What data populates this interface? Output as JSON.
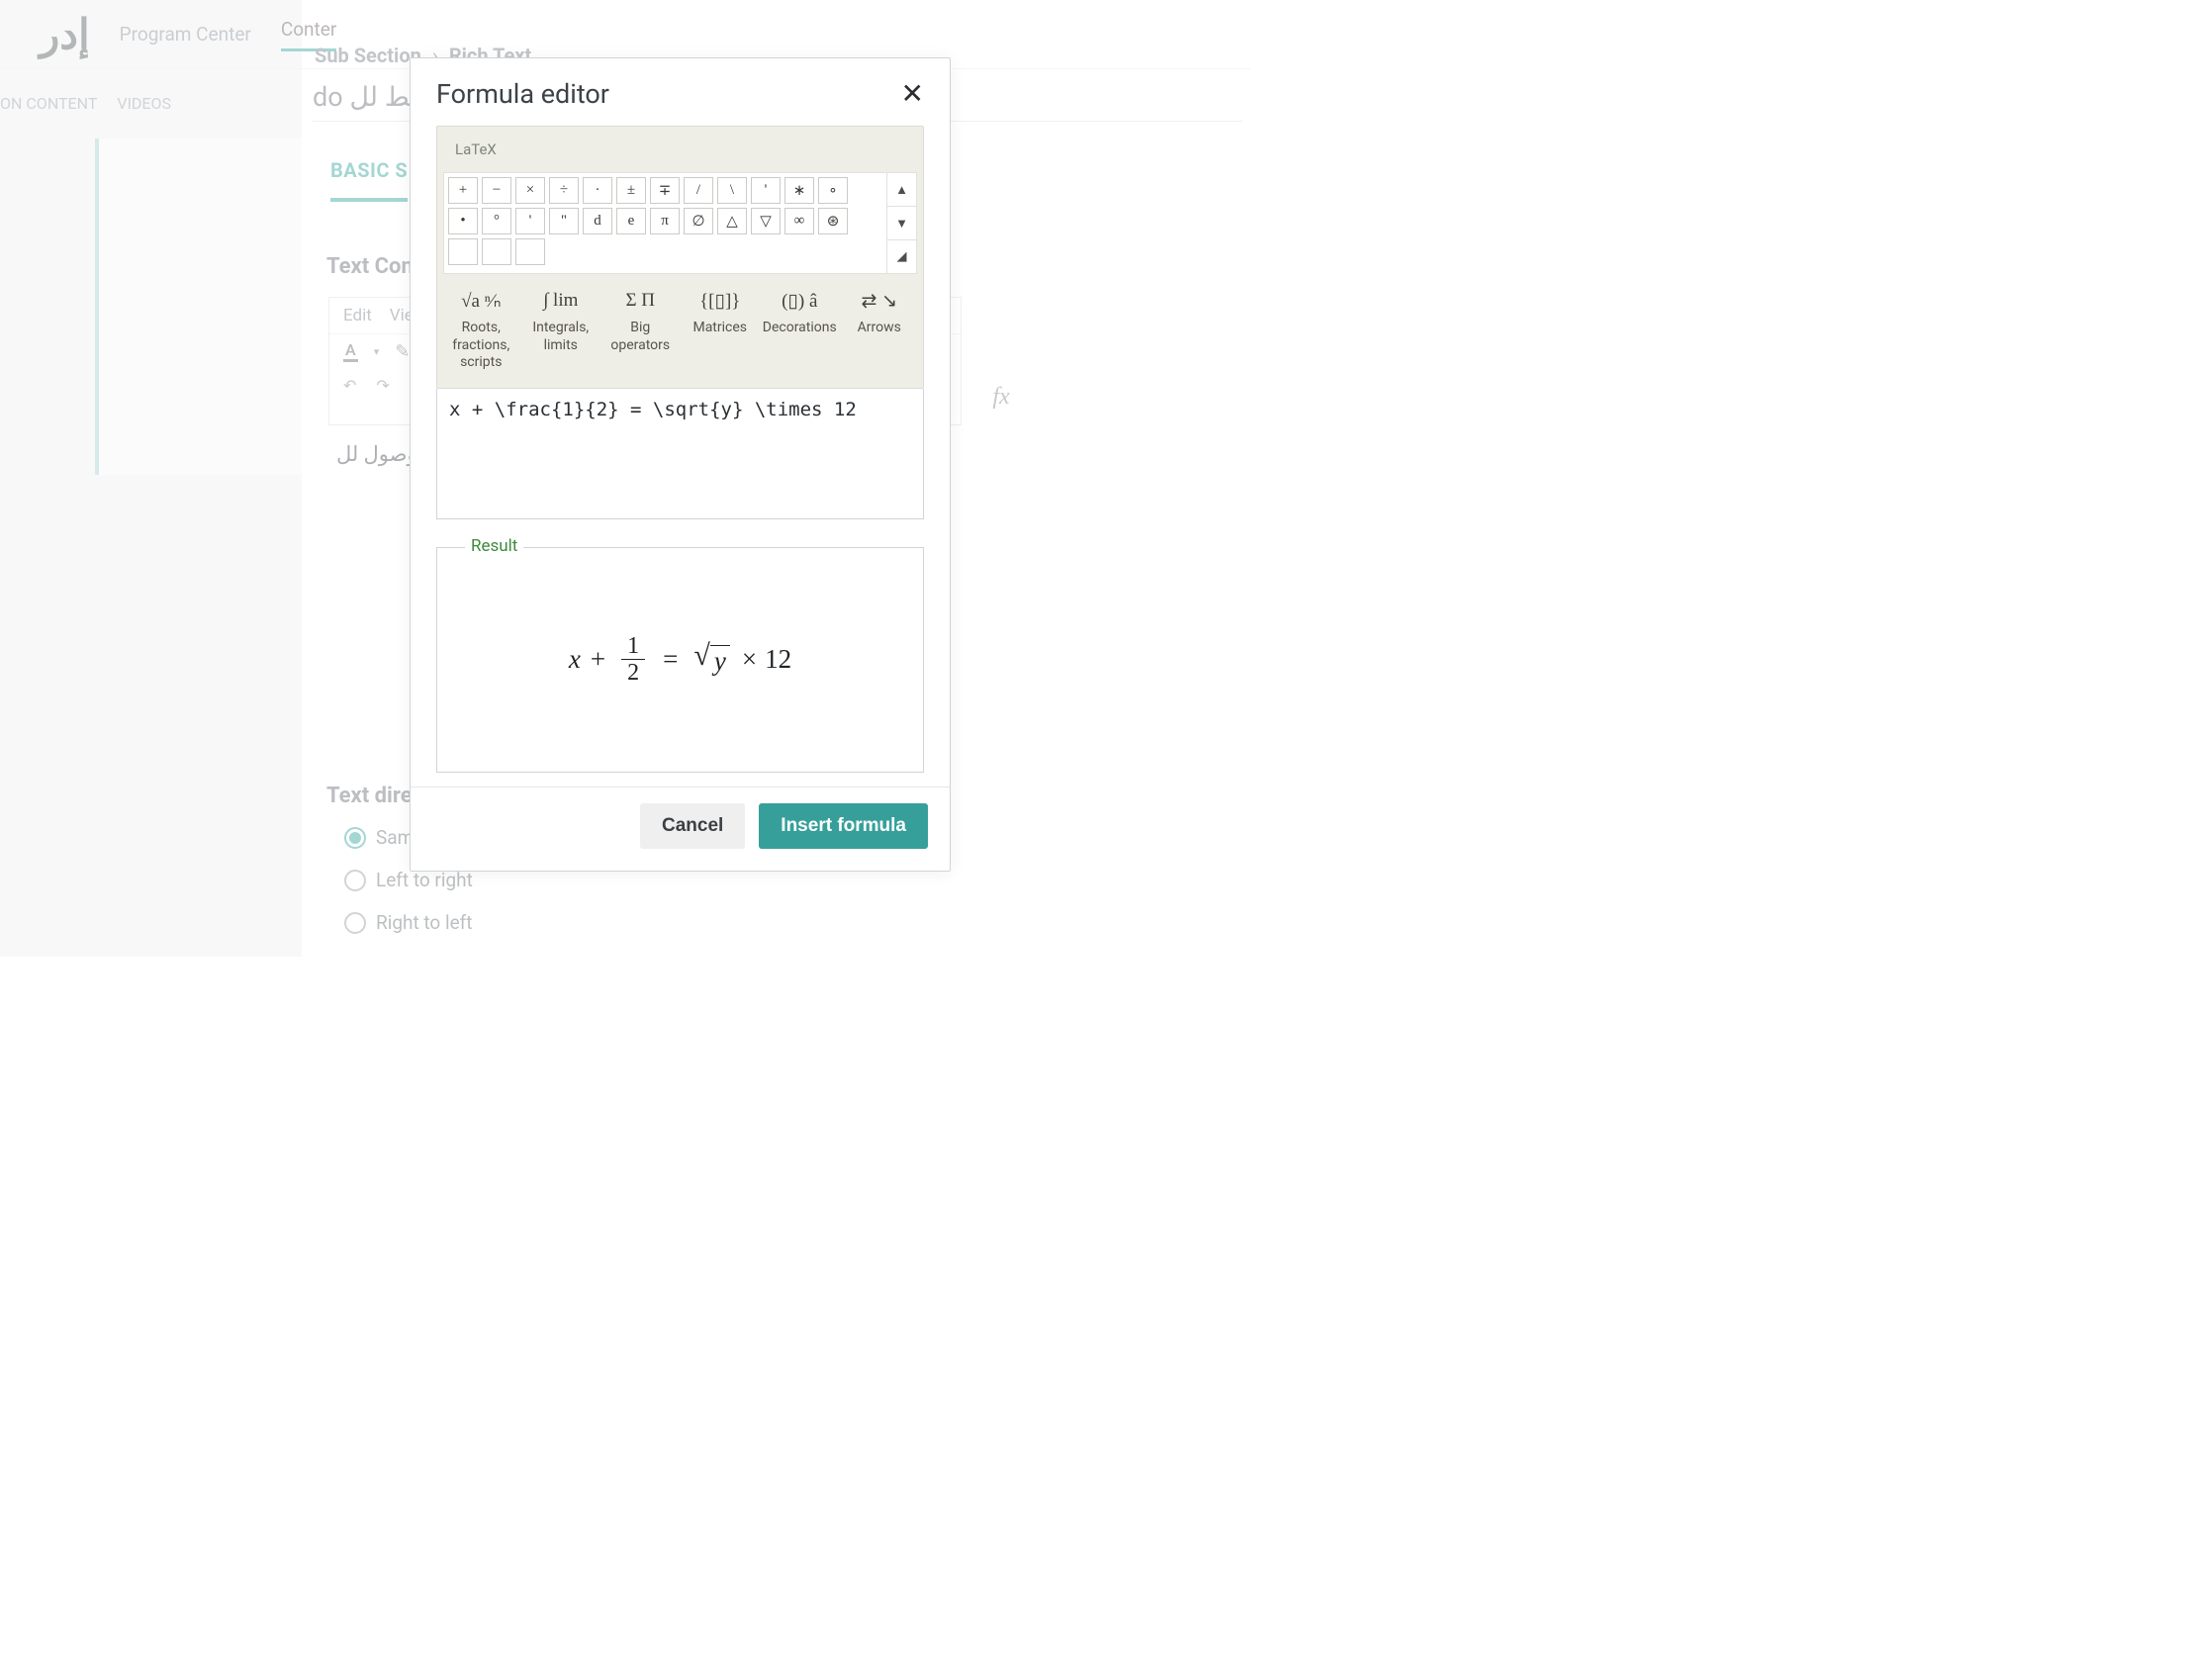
{
  "topnav": {
    "program_center": "Program Center",
    "content": "Conter"
  },
  "subnav": {
    "on_content": "ON CONTENT",
    "videos": "VIDEOS"
  },
  "breadcrumb": {
    "a": "Sub Section",
    "sep": "›",
    "b": "Rich Text"
  },
  "title": "do رابط لل",
  "tabs": {
    "basic": "BASIC S"
  },
  "sections": {
    "text_content": "Text Con",
    "text_direction": "Text dire"
  },
  "menubar": {
    "edit": "Edit",
    "view": "Vie"
  },
  "arabic_body": "الوصول لل",
  "fx": "fx",
  "radios": {
    "same": "Sam",
    "ltr": "Left to right",
    "rtl": "Right to left"
  },
  "modal": {
    "title": "Formula editor",
    "latex_label": "LaTeX",
    "input": "x + \\frac{1}{2} = \\sqrt{y} \\times 12",
    "result_label": "Result",
    "cancel": "Cancel",
    "insert": "Insert formula"
  },
  "symbols": {
    "row1": [
      "+",
      "−",
      "×",
      "÷",
      "·",
      "±",
      "∓",
      "/",
      "\\",
      "'",
      "∗",
      "∘"
    ],
    "row2": [
      "•",
      "°",
      "'",
      "''",
      "d",
      "e",
      "π",
      "∅",
      "△",
      "▽",
      "∞",
      "⊛"
    ]
  },
  "cats": {
    "roots": {
      "icon": "√a ⁿ⁄ₙ",
      "label": "Roots, fractions, scripts"
    },
    "integrals": {
      "icon": "∫ lim",
      "label": "Integrals, limits"
    },
    "bigops": {
      "icon": "Σ Π",
      "label": "Big operators"
    },
    "matrices": {
      "icon": "{[▯]}",
      "label": "Matrices"
    },
    "decor": {
      "icon": "(▯) â",
      "label": "Decorations"
    },
    "arrows": {
      "icon": "⇄ ↘",
      "label": "Arrows"
    }
  },
  "rendered": {
    "x": "x",
    "plus": "+",
    "num": "1",
    "den": "2",
    "eq": "=",
    "y": "y",
    "times": "×",
    "twelve": "12"
  }
}
